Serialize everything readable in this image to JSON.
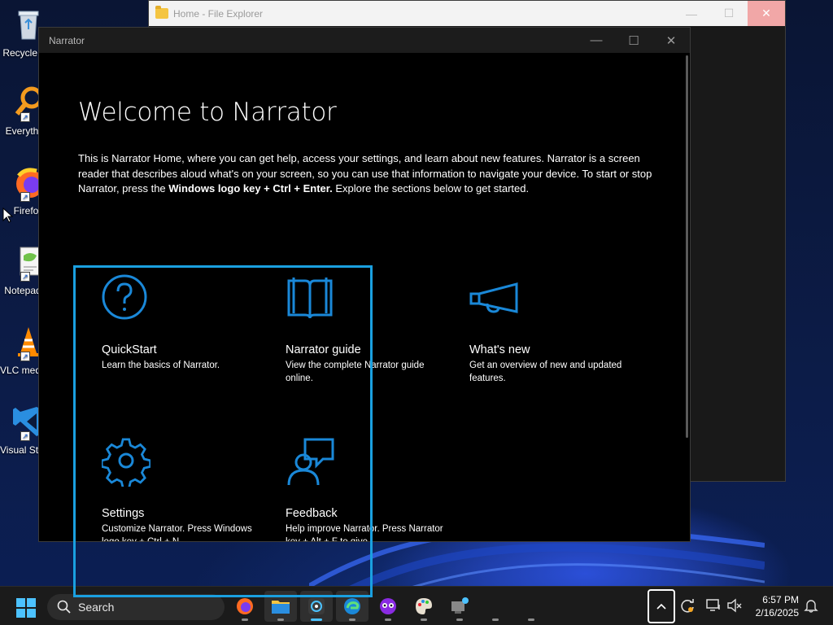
{
  "desktop": {
    "icons": [
      {
        "id": "recycle",
        "label": "Recycle Bin"
      },
      {
        "id": "everything",
        "label": "Everything"
      },
      {
        "id": "firefox",
        "label": "Firefox"
      },
      {
        "id": "notepad",
        "label": "Notepad++"
      },
      {
        "id": "vlc",
        "label": "VLC media player"
      },
      {
        "id": "vscode",
        "label": "Visual Studio Code"
      }
    ]
  },
  "explorer": {
    "title": "Home - File Explorer"
  },
  "narrator": {
    "window_title": "Narrator",
    "heading": "Welcome to Narrator",
    "intro_line1": "This is Narrator Home, where you can get help, access your settings, and learn about new features. Narrator is a screen reader that describes aloud what's on your screen, so you can use that information to navigate your device. To start or stop Narrator, press the ",
    "intro_bold": "Windows logo key + Ctrl + Enter.",
    "intro_line2": " Explore the sections below to get started.",
    "tiles": [
      {
        "title": "QuickStart",
        "description": "Learn the basics of Narrator.",
        "icon": "question-icon"
      },
      {
        "title": "Narrator guide",
        "description": "View the complete Narrator guide online.",
        "icon": "book-icon"
      },
      {
        "title": "What's new",
        "description": "Get an overview of new and updated features.",
        "icon": "megaphone-icon"
      },
      {
        "title": "Settings",
        "description": "Customize Narrator. Press Windows logo key + Ctrl + N",
        "icon": "gear-icon"
      },
      {
        "title": "Feedback",
        "description": "Help improve Narrator. Press Narrator key + Alt + F to give",
        "icon": "feedback-icon"
      }
    ],
    "accent_color": "#1a88d8"
  },
  "taskbar": {
    "search_placeholder": "Search",
    "clock_time": "6:57 PM",
    "clock_date": "2/16/2025"
  }
}
